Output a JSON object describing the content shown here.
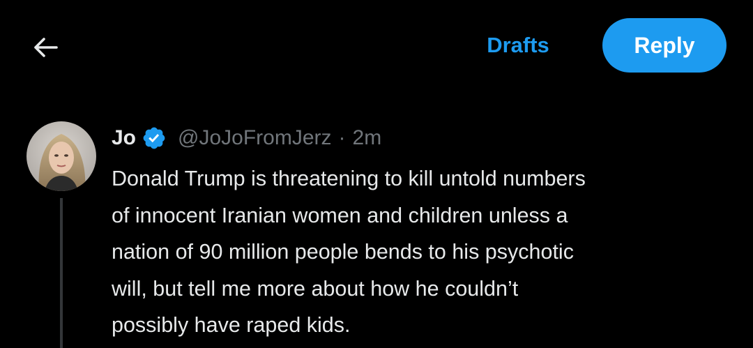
{
  "header": {
    "back_icon": "arrow-left-icon",
    "drafts_label": "Drafts",
    "reply_label": "Reply"
  },
  "tweet": {
    "author_name": "Jo",
    "verified_icon": "verified-badge-icon",
    "handle": "@JoJoFromJerz",
    "separator": "·",
    "time": "2m",
    "text_lines": [
      "Donald Trump is threatening to kill untold numbers",
      "of innocent Iranian women and children unless a",
      "nation of 90 million people bends to his psychotic",
      "will, but tell me more about how he couldn’t",
      "possibly have raped kids."
    ]
  },
  "colors": {
    "background": "#000000",
    "accent": "#1d9bf0",
    "text_primary": "#e7e9ea",
    "text_secondary": "#71767b",
    "reply_button_bg": "#1d9bf0",
    "reply_button_text": "#ffffff",
    "thread_line": "#333639"
  }
}
